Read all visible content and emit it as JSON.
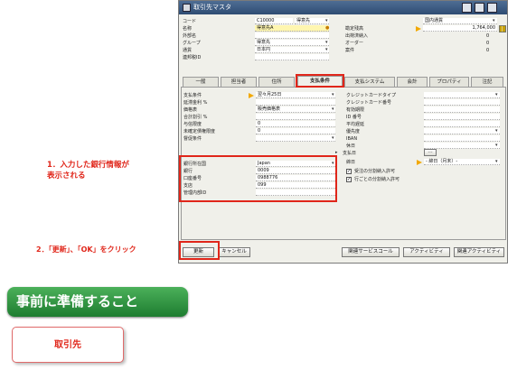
{
  "window": {
    "title": "取引先マスタ"
  },
  "header_left": {
    "rows": [
      {
        "label": "コード",
        "value": "C10000",
        "extra": "得意先"
      },
      {
        "label": "名称",
        "value": "得意先A"
      },
      {
        "label": "外部名",
        "value": ""
      },
      {
        "label": "グループ",
        "value": "得意先"
      },
      {
        "label": "通貨",
        "value": "日本円"
      },
      {
        "label": "連邦税ID",
        "value": ""
      }
    ]
  },
  "header_right": {
    "currency": "国内通貨",
    "rows": [
      {
        "label": "勘定残高",
        "value": "1,764,000"
      },
      {
        "label": "出荷済納入",
        "value": "0"
      },
      {
        "label": "オーダー",
        "value": "0"
      },
      {
        "label": "案件",
        "value": "0"
      }
    ]
  },
  "tabs": [
    "一般",
    "担当者",
    "住所",
    "支払条件",
    "支払システム",
    "会計",
    "プロパティ",
    "注記"
  ],
  "payment_left": [
    {
      "label": "支払条件",
      "value": "翌々月25日"
    },
    {
      "label": "延滞金利 %",
      "value": ""
    },
    {
      "label": "価格表",
      "value": "販売価格表"
    },
    {
      "label": "合計割引 %",
      "value": ""
    },
    {
      "label": "与信限度",
      "value": "0"
    },
    {
      "label": "未確定債権限度",
      "value": "0"
    },
    {
      "label": "督促条件",
      "value": ""
    }
  ],
  "bank": [
    {
      "label": "銀行所在国",
      "value": "Japan"
    },
    {
      "label": "銀行",
      "value": "0009"
    },
    {
      "label": "口座番号",
      "value": "0988776"
    },
    {
      "label": "支店",
      "value": "099"
    },
    {
      "label": "管理内部ID",
      "value": ""
    }
  ],
  "payment_right": [
    {
      "label": "クレジットカードタイプ",
      "value": ""
    },
    {
      "label": "クレジットカード番号",
      "value": ""
    },
    {
      "label": "有効期限",
      "value": ""
    },
    {
      "label": "ID 番号",
      "value": ""
    },
    {
      "label": "平均遅延",
      "value": ""
    },
    {
      "label": "優先度",
      "value": ""
    },
    {
      "label": "IBAN",
      "value": ""
    },
    {
      "label": "休日",
      "value": ""
    }
  ],
  "payment_date_label": "支払日",
  "closing_label": "締日",
  "closing_value": "- 締日（月末）-",
  "checkboxes": [
    {
      "label": "受注の分割納入許可",
      "checked": true
    },
    {
      "label": "行ごとの分割納入許可",
      "checked": true
    }
  ],
  "buttons": {
    "update": "更新",
    "cancel": "キャンセル",
    "service": "関連サービスコール",
    "activity": "アクティビティ",
    "related_activity": "関連アクティビティ"
  },
  "annotations": {
    "bank_note_line1": "1．入力した銀行情報が",
    "bank_note_line2": "表示される",
    "click_note": "2．「更新」、「OK」をクリック"
  },
  "section_title": "事前に準備すること",
  "card_label": "取引先",
  "colors": {
    "accent_red": "#e0261a",
    "green": "#2e9a42",
    "title_blue": "#2f4c73"
  }
}
